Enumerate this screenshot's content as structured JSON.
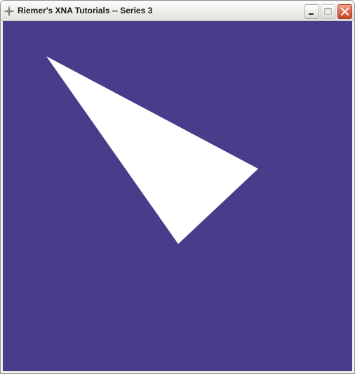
{
  "window": {
    "title": "Riemer's XNA Tutorials -- Series 3",
    "app_icon": "xna-icon",
    "controls": {
      "minimize_icon": "minimize-icon",
      "maximize_icon": "maximize-icon",
      "close_icon": "close-icon"
    }
  },
  "viewport": {
    "clear_color": "#483d8b",
    "triangle_color": "#ffffff"
  }
}
